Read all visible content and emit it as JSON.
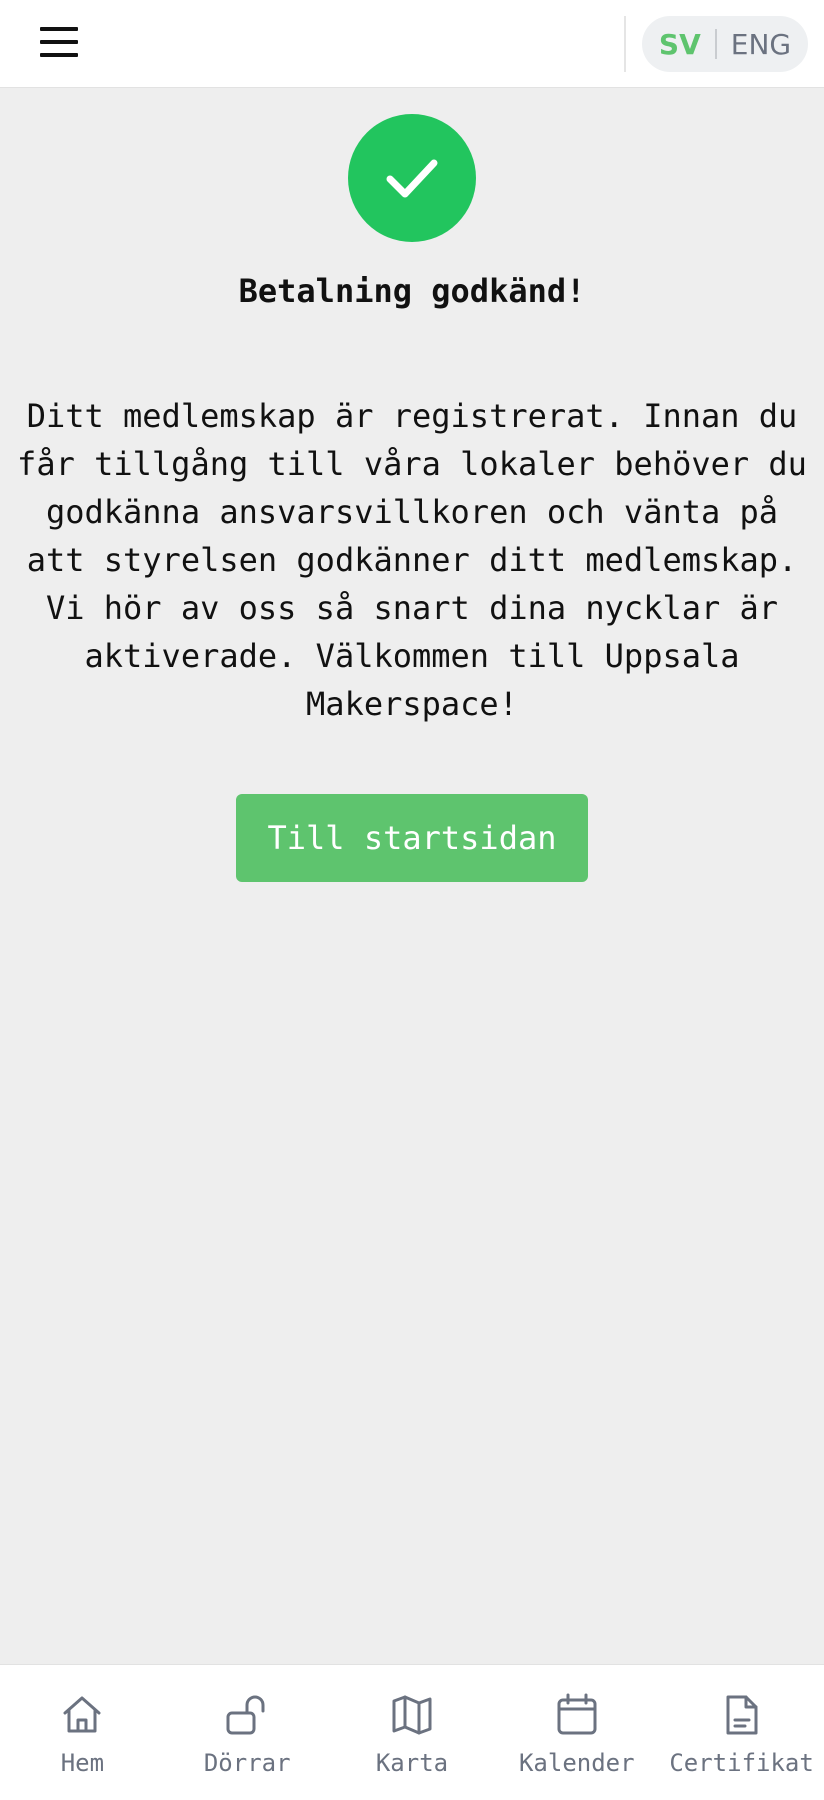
{
  "header": {
    "menu_icon": "hamburger-menu-icon",
    "languages": {
      "active": "SV",
      "inactive": "ENG"
    },
    "colors": {
      "active_language": "#5ec46e",
      "inactive_language": "#6b7280"
    }
  },
  "status": {
    "icon": "check-icon",
    "color": "#22c55e",
    "title": "Betalning godkänd!",
    "message": "Ditt medlemskap är registrerat. Innan du får tillgång till våra lokaler behöver du godkänna ansvarsvillkoren och vänta på att styrelsen godkänner ditt medlemskap. Vi hör av oss så snart dina nycklar är aktiverade. Välkommen till Uppsala Makerspace!"
  },
  "actions": {
    "home_button": "Till startsidan",
    "button_color": "#5ec46e"
  },
  "bottom_nav": {
    "items": [
      {
        "label": "Hem",
        "icon": "home-icon"
      },
      {
        "label": "Dörrar",
        "icon": "unlock-icon"
      },
      {
        "label": "Karta",
        "icon": "map-icon"
      },
      {
        "label": "Kalender",
        "icon": "calendar-icon"
      },
      {
        "label": "Certifikat",
        "icon": "document-icon"
      }
    ]
  }
}
